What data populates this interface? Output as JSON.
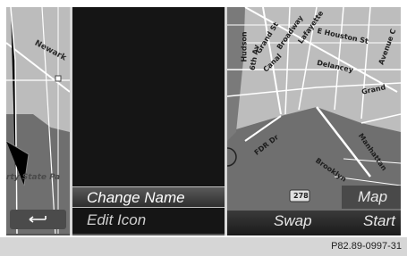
{
  "map_left": {
    "labels": [
      "Newark",
      "rty State Pa"
    ]
  },
  "menu": {
    "items": [
      {
        "label": "Change Name",
        "selected": true
      },
      {
        "label": "Edit Icon",
        "selected": false
      }
    ]
  },
  "map_right": {
    "streets": [
      "Grand St",
      "Broadway",
      "Lafayette",
      "Canal",
      "Delancey",
      "E Houston St",
      "Hudson",
      "6th Av",
      "Avenue C",
      "Grand",
      "FDR Dr",
      "Manhattan",
      "Brooklyn",
      "278"
    ],
    "map_button": "Map",
    "swap_button": "Swap",
    "start_button": "Start"
  },
  "footer": {
    "code": "P82.89-0997-31"
  },
  "colors": {
    "selection_bg": "#4a4a4a",
    "map_land": "#bfbfbf",
    "map_water": "#6f6f6f"
  }
}
